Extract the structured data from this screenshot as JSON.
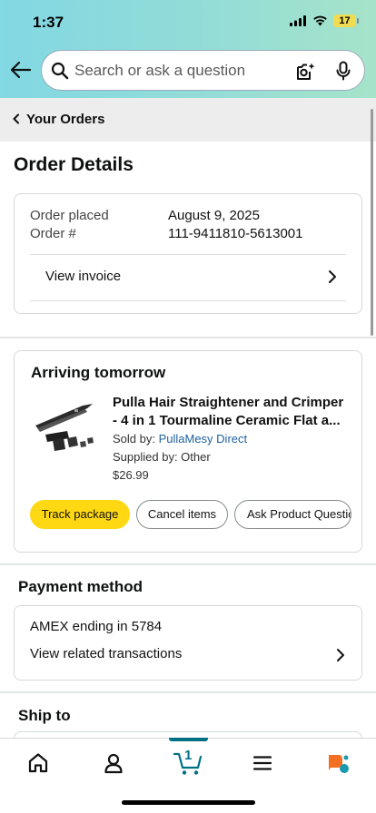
{
  "status_bar": {
    "time": "1:37",
    "battery": "17"
  },
  "search": {
    "placeholder": "Search or ask a question"
  },
  "breadcrumb": {
    "label": "Your Orders"
  },
  "page_title": "Order Details",
  "order_info": {
    "placed_label": "Order placed",
    "placed_value": "August 9, 2025",
    "number_label": "Order #",
    "number_value": "111-9411810-5613001",
    "invoice_label": "View invoice"
  },
  "shipment": {
    "title": "Arriving tomorrow",
    "product_name_line1": "Pulla Hair Straightener and Crimper",
    "product_name_line2": "- 4 in 1 Tourmaline Ceramic Flat a...",
    "sold_by_label": "Sold by: ",
    "sold_by_value": "PullaMesy Direct",
    "supplied_by": "Supplied by: Other",
    "price": "$26.99",
    "buttons": {
      "track": "Track package",
      "cancel": "Cancel items",
      "ask": "Ask Product Question"
    }
  },
  "payment": {
    "heading": "Payment method",
    "card": "AMEX ending in 5784",
    "transactions_label": "View related transactions"
  },
  "ship_to": {
    "heading": "Ship to"
  },
  "bottom_nav": {
    "cart_count": "1"
  },
  "colors": {
    "accent": "#007185",
    "button_yellow": "#FFD814",
    "link": "#2162A1"
  },
  "icons": [
    "back-arrow-icon",
    "search-icon",
    "camera-icon",
    "mic-icon",
    "home-icon",
    "account-icon",
    "cart-icon",
    "menu-icon",
    "rufus-icon",
    "chevron-right-icon",
    "chevron-left-icon"
  ]
}
